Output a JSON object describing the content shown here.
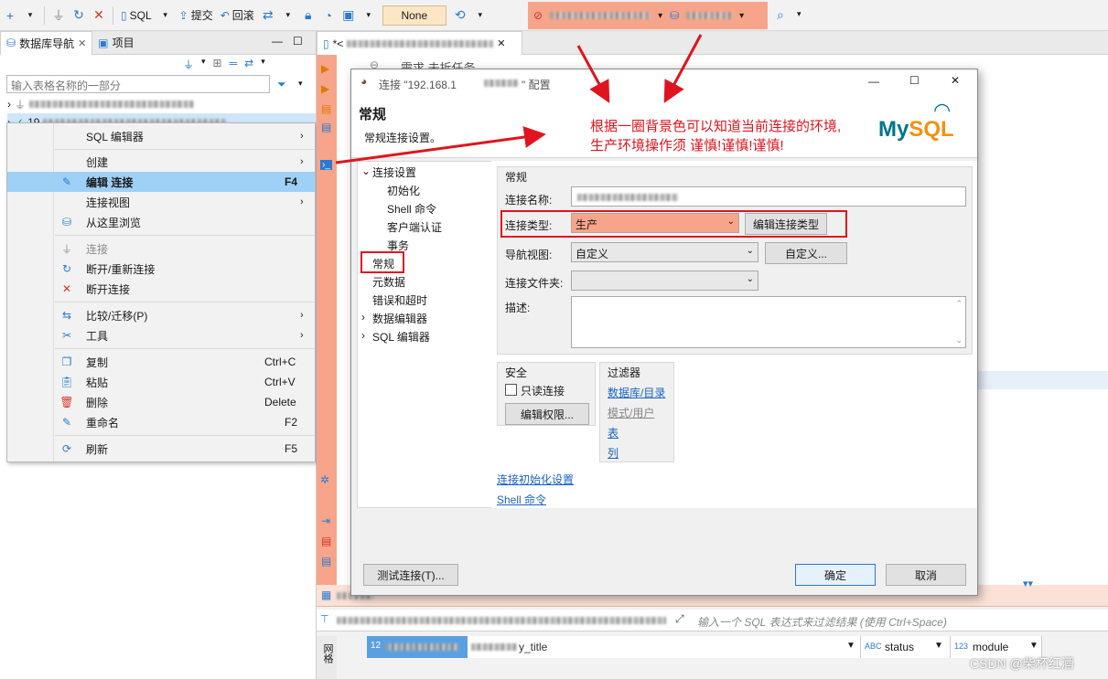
{
  "toolbar": {
    "sql_label": "SQL",
    "commit_label": "提交",
    "rollback_label": "回滚",
    "none_label": "None"
  },
  "left_panel": {
    "tab_db_nav": "数据库导航",
    "tab_projects": "项目",
    "filter_placeholder": "输入表格名称的一部分",
    "tree_prefix": "19"
  },
  "context_menu": {
    "items": [
      {
        "label": "SQL 编辑器",
        "shortcut": "",
        "submenu": true
      },
      {
        "label": "创建",
        "shortcut": "",
        "submenu": true
      },
      {
        "label": "编辑 连接",
        "shortcut": "F4",
        "submenu": false
      },
      {
        "label": "连接视图",
        "shortcut": "",
        "submenu": true
      },
      {
        "label": "从这里浏览",
        "shortcut": "",
        "submenu": false
      },
      {
        "label": "连接",
        "shortcut": "",
        "submenu": false
      },
      {
        "label": "断开/重新连接",
        "shortcut": "",
        "submenu": false
      },
      {
        "label": "断开连接",
        "shortcut": "",
        "submenu": false
      },
      {
        "label": "比较/迁移(P)",
        "shortcut": "",
        "submenu": true
      },
      {
        "label": "工具",
        "shortcut": "",
        "submenu": true
      },
      {
        "label": "复制",
        "shortcut": "Ctrl+C",
        "submenu": false
      },
      {
        "label": "粘贴",
        "shortcut": "Ctrl+V",
        "submenu": false
      },
      {
        "label": "删除",
        "shortcut": "Delete",
        "submenu": false
      },
      {
        "label": "重命名",
        "shortcut": "F2",
        "submenu": false
      },
      {
        "label": "刷新",
        "shortcut": "F5",
        "submenu": false
      }
    ]
  },
  "editor": {
    "tab_label": "*<",
    "line1": "需求 未拆任务"
  },
  "dialog": {
    "title_prefix": "连接 \"192.168.1",
    "title_suffix": "\" 配置",
    "section_title": "常规",
    "section_subtitle": "常规连接设置。",
    "logo_text": "MySQL",
    "nav": {
      "conn_settings": "连接设置",
      "init": "初始化",
      "shell_cmd": "Shell 命令",
      "client_auth": "客户端认证",
      "transactions": "事务",
      "general": "常规",
      "metadata": "元数据",
      "errors_timeouts": "错误和超时",
      "data_editor": "数据编辑器",
      "sql_editor": "SQL 编辑器"
    },
    "form": {
      "group_title": "常规",
      "conn_name_label": "连接名称:",
      "conn_type_label": "连接类型:",
      "conn_type_value": "生产",
      "edit_conn_type_btn": "编辑连接类型",
      "nav_view_label": "导航视图:",
      "nav_view_value": "自定义",
      "customize_btn": "自定义...",
      "conn_folder_label": "连接文件夹:",
      "description_label": "描述:",
      "security_title": "安全",
      "readonly_label": "只读连接",
      "edit_perms_btn": "编辑权限...",
      "filters_title": "过滤器",
      "filter_db": "数据库/目录",
      "filter_schema": "模式/用户",
      "filter_table": "表",
      "filter_column": "列",
      "link_init": "连接初始化设置",
      "link_shell": "Shell 命令"
    },
    "test_btn": "测试连接(T)...",
    "ok_btn": "确定",
    "cancel_btn": "取消"
  },
  "annotation": {
    "line1": "根据一圈背景色可以知道当前连接的环境,",
    "line2": "生产环境操作须 谨慎!谨慎!谨慎!"
  },
  "bottom": {
    "filter_placeholder": "输入一个 SQL 表达式来过滤结果 (使用 Ctrl+Space)",
    "col_status": "status",
    "col_module": "module",
    "col_title_suffix": "y_title",
    "side_label": "网格"
  },
  "watermark": "CSDN @柴杯红酒",
  "colors": {
    "production": "#f6a58a",
    "annotation_red": "#e0141e",
    "selection": "#9fd0f5",
    "link": "#1a63c4"
  }
}
